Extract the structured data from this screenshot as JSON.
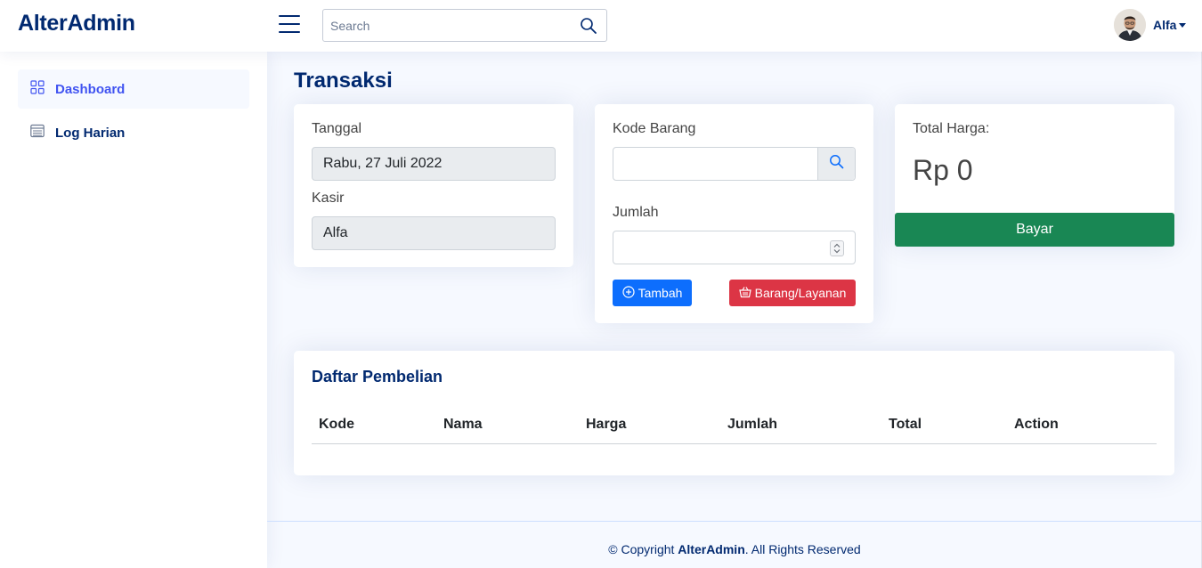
{
  "app": {
    "logo_text": "AlterAdmin"
  },
  "header": {
    "search_placeholder": "Search",
    "user_name": "Alfa"
  },
  "sidebar": {
    "items": [
      {
        "label": "Dashboard",
        "icon": "grid-icon",
        "active": true
      },
      {
        "label": "Log Harian",
        "icon": "layout-text-window-icon",
        "active": false
      }
    ]
  },
  "main": {
    "title": "Transaksi",
    "info_card": {
      "date_label": "Tanggal",
      "date_value": "Rabu, 27 Juli 2022",
      "cashier_label": "Kasir",
      "cashier_value": "Alfa"
    },
    "input_card": {
      "code_label": "Kode Barang",
      "code_value": "",
      "qty_label": "Jumlah",
      "qty_value": "",
      "add_button": "Tambah",
      "items_button": "Barang/Layanan"
    },
    "total_card": {
      "label": "Total Harga:",
      "value": "Rp 0",
      "pay_button": "Bayar"
    },
    "purchase_list": {
      "title": "Daftar Pembelian",
      "columns": [
        "Kode",
        "Nama",
        "Harga",
        "Jumlah",
        "Total",
        "Action"
      ],
      "rows": []
    }
  },
  "footer": {
    "prefix": "© Copyright ",
    "brand": "AlterAdmin",
    "suffix": ". All Rights Reserved"
  },
  "colors": {
    "brand": "#012970",
    "accent": "#4154f1",
    "primary_button": "#0d6efd",
    "danger_button": "#dc3545",
    "success_button": "#198754",
    "background": "#f6f9ff"
  }
}
